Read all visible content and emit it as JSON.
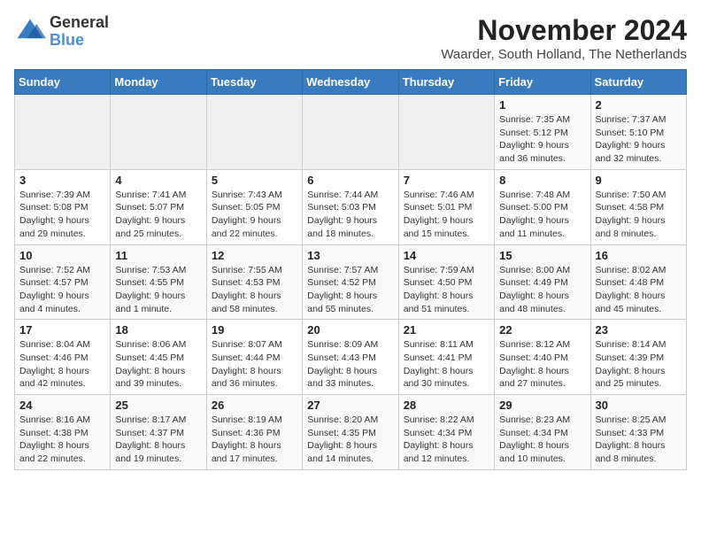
{
  "logo": {
    "general": "General",
    "blue": "Blue"
  },
  "title": "November 2024",
  "location": "Waarder, South Holland, The Netherlands",
  "weekdays": [
    "Sunday",
    "Monday",
    "Tuesday",
    "Wednesday",
    "Thursday",
    "Friday",
    "Saturday"
  ],
  "weeks": [
    [
      {
        "day": "",
        "info": ""
      },
      {
        "day": "",
        "info": ""
      },
      {
        "day": "",
        "info": ""
      },
      {
        "day": "",
        "info": ""
      },
      {
        "day": "",
        "info": ""
      },
      {
        "day": "1",
        "info": "Sunrise: 7:35 AM\nSunset: 5:12 PM\nDaylight: 9 hours and 36 minutes."
      },
      {
        "day": "2",
        "info": "Sunrise: 7:37 AM\nSunset: 5:10 PM\nDaylight: 9 hours and 32 minutes."
      }
    ],
    [
      {
        "day": "3",
        "info": "Sunrise: 7:39 AM\nSunset: 5:08 PM\nDaylight: 9 hours and 29 minutes."
      },
      {
        "day": "4",
        "info": "Sunrise: 7:41 AM\nSunset: 5:07 PM\nDaylight: 9 hours and 25 minutes."
      },
      {
        "day": "5",
        "info": "Sunrise: 7:43 AM\nSunset: 5:05 PM\nDaylight: 9 hours and 22 minutes."
      },
      {
        "day": "6",
        "info": "Sunrise: 7:44 AM\nSunset: 5:03 PM\nDaylight: 9 hours and 18 minutes."
      },
      {
        "day": "7",
        "info": "Sunrise: 7:46 AM\nSunset: 5:01 PM\nDaylight: 9 hours and 15 minutes."
      },
      {
        "day": "8",
        "info": "Sunrise: 7:48 AM\nSunset: 5:00 PM\nDaylight: 9 hours and 11 minutes."
      },
      {
        "day": "9",
        "info": "Sunrise: 7:50 AM\nSunset: 4:58 PM\nDaylight: 9 hours and 8 minutes."
      }
    ],
    [
      {
        "day": "10",
        "info": "Sunrise: 7:52 AM\nSunset: 4:57 PM\nDaylight: 9 hours and 4 minutes."
      },
      {
        "day": "11",
        "info": "Sunrise: 7:53 AM\nSunset: 4:55 PM\nDaylight: 9 hours and 1 minute."
      },
      {
        "day": "12",
        "info": "Sunrise: 7:55 AM\nSunset: 4:53 PM\nDaylight: 8 hours and 58 minutes."
      },
      {
        "day": "13",
        "info": "Sunrise: 7:57 AM\nSunset: 4:52 PM\nDaylight: 8 hours and 55 minutes."
      },
      {
        "day": "14",
        "info": "Sunrise: 7:59 AM\nSunset: 4:50 PM\nDaylight: 8 hours and 51 minutes."
      },
      {
        "day": "15",
        "info": "Sunrise: 8:00 AM\nSunset: 4:49 PM\nDaylight: 8 hours and 48 minutes."
      },
      {
        "day": "16",
        "info": "Sunrise: 8:02 AM\nSunset: 4:48 PM\nDaylight: 8 hours and 45 minutes."
      }
    ],
    [
      {
        "day": "17",
        "info": "Sunrise: 8:04 AM\nSunset: 4:46 PM\nDaylight: 8 hours and 42 minutes."
      },
      {
        "day": "18",
        "info": "Sunrise: 8:06 AM\nSunset: 4:45 PM\nDaylight: 8 hours and 39 minutes."
      },
      {
        "day": "19",
        "info": "Sunrise: 8:07 AM\nSunset: 4:44 PM\nDaylight: 8 hours and 36 minutes."
      },
      {
        "day": "20",
        "info": "Sunrise: 8:09 AM\nSunset: 4:43 PM\nDaylight: 8 hours and 33 minutes."
      },
      {
        "day": "21",
        "info": "Sunrise: 8:11 AM\nSunset: 4:41 PM\nDaylight: 8 hours and 30 minutes."
      },
      {
        "day": "22",
        "info": "Sunrise: 8:12 AM\nSunset: 4:40 PM\nDaylight: 8 hours and 27 minutes."
      },
      {
        "day": "23",
        "info": "Sunrise: 8:14 AM\nSunset: 4:39 PM\nDaylight: 8 hours and 25 minutes."
      }
    ],
    [
      {
        "day": "24",
        "info": "Sunrise: 8:16 AM\nSunset: 4:38 PM\nDaylight: 8 hours and 22 minutes."
      },
      {
        "day": "25",
        "info": "Sunrise: 8:17 AM\nSunset: 4:37 PM\nDaylight: 8 hours and 19 minutes."
      },
      {
        "day": "26",
        "info": "Sunrise: 8:19 AM\nSunset: 4:36 PM\nDaylight: 8 hours and 17 minutes."
      },
      {
        "day": "27",
        "info": "Sunrise: 8:20 AM\nSunset: 4:35 PM\nDaylight: 8 hours and 14 minutes."
      },
      {
        "day": "28",
        "info": "Sunrise: 8:22 AM\nSunset: 4:34 PM\nDaylight: 8 hours and 12 minutes."
      },
      {
        "day": "29",
        "info": "Sunrise: 8:23 AM\nSunset: 4:34 PM\nDaylight: 8 hours and 10 minutes."
      },
      {
        "day": "30",
        "info": "Sunrise: 8:25 AM\nSunset: 4:33 PM\nDaylight: 8 hours and 8 minutes."
      }
    ]
  ]
}
